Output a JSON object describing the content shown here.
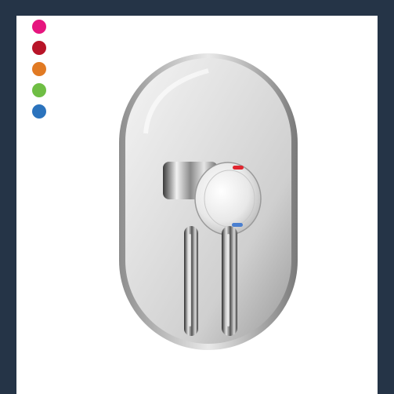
{
  "swatches": [
    {
      "name": "magenta",
      "color": "#e6157e"
    },
    {
      "name": "crimson",
      "color": "#b81428"
    },
    {
      "name": "orange",
      "color": "#e17a23"
    },
    {
      "name": "green",
      "color": "#6fbe44"
    },
    {
      "name": "blue",
      "color": "#2b73bd"
    }
  ],
  "product": {
    "indicator_hot": "#e0252f",
    "indicator_cold": "#4a7fd0"
  }
}
